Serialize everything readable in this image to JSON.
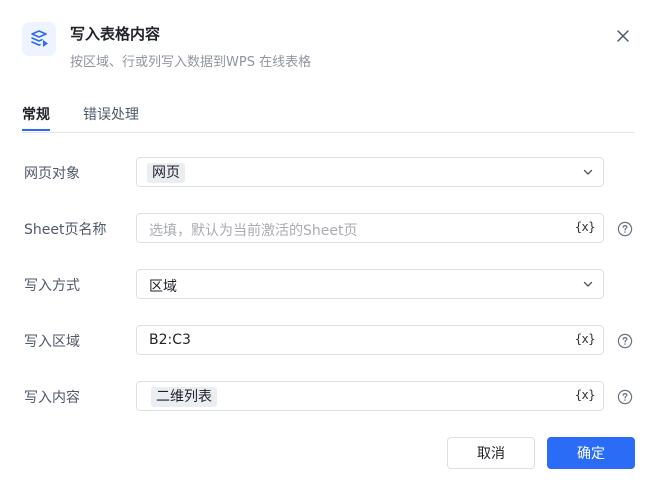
{
  "header": {
    "title": "写入表格内容",
    "subtitle": "按区域、行或列写入数据到WPS 在线表格",
    "icon": "table-write-icon",
    "close_icon": "close-icon"
  },
  "tabs": [
    {
      "label": "常规",
      "active": true
    },
    {
      "label": "错误处理",
      "active": false
    }
  ],
  "form": {
    "web_object": {
      "label": "网页对象",
      "value": "网页"
    },
    "sheet_name": {
      "label": "Sheet页名称",
      "placeholder": "选填，默认为当前激活的Sheet页",
      "var_label": "{x}"
    },
    "write_mode": {
      "label": "写入方式",
      "value": "区域"
    },
    "write_range": {
      "label": "写入区域",
      "value": "B2:C3",
      "var_label": "{x}"
    },
    "write_content": {
      "label": "写入内容",
      "value": "二维列表",
      "var_label": "{x}"
    }
  },
  "buttons": {
    "cancel": "取消",
    "ok": "确定"
  },
  "colors": {
    "primary": "#2a6cf6",
    "border": "#dcdfe6",
    "chip_bg": "#eaedf2"
  }
}
